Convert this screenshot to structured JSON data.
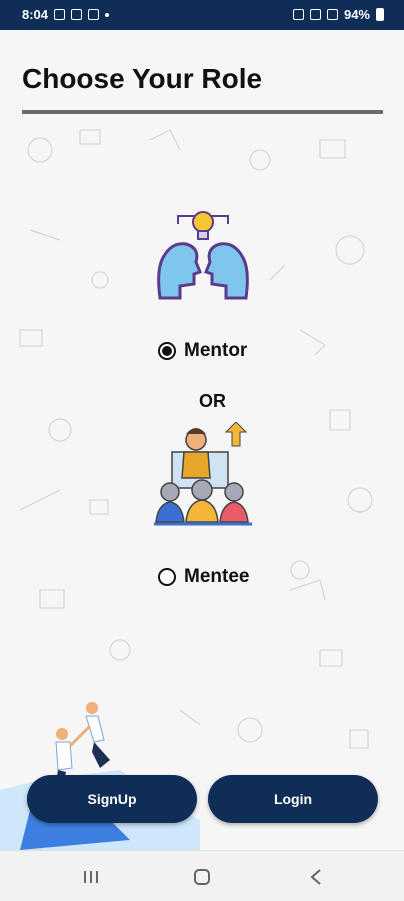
{
  "status_bar": {
    "time": "8:04",
    "battery": "94%"
  },
  "page": {
    "title": "Choose Your Role"
  },
  "roles": {
    "mentor_label": "Mentor",
    "or_label": "OR",
    "mentee_label": "Mentee",
    "selected": "Mentor"
  },
  "buttons": {
    "signup_label": "SignUp",
    "login_label": "Login"
  },
  "colors": {
    "primary": "#0f2d57",
    "text": "#111111"
  },
  "icons": {
    "mentor": "mentor-heads-lightbulb-icon",
    "mentee": "mentee-group-icon",
    "nav_recent": "recent-apps-icon",
    "nav_home": "home-icon",
    "nav_back": "back-icon"
  }
}
